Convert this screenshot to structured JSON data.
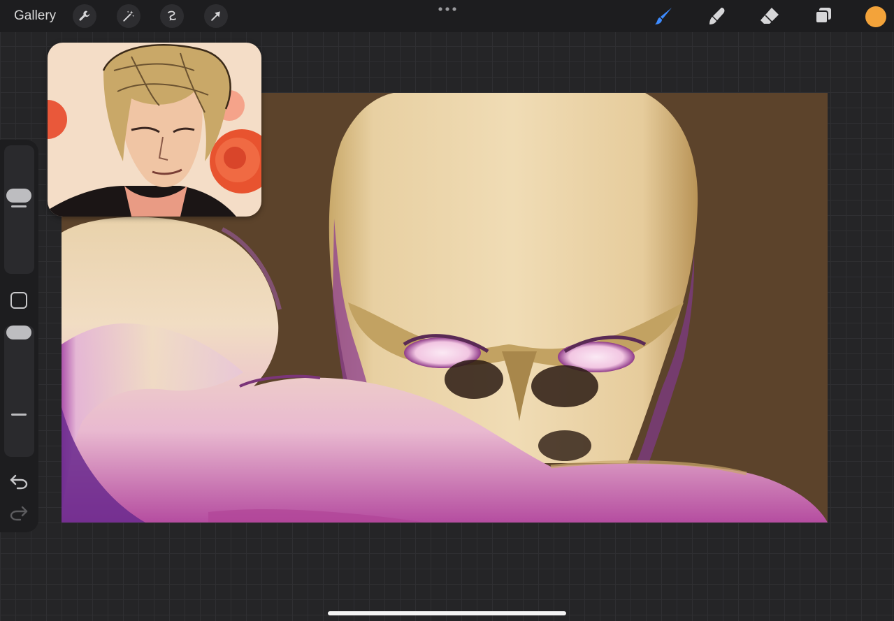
{
  "topbar": {
    "gallery_label": "Gallery",
    "left_tools": [
      "wrench-icon",
      "magic-wand-icon",
      "selection-icon",
      "transform-arrow-icon"
    ],
    "right_tools": [
      "brush-icon",
      "smudge-icon",
      "eraser-icon",
      "layers-icon"
    ],
    "active_tool": "brush-icon",
    "active_tool_color": "#3d8bff",
    "current_color": "#f3a33a"
  },
  "canvas": {
    "background_color": "#5c432b"
  },
  "sidebar": {
    "brush_size_level": 0.62,
    "opacity_level": 0.35,
    "undo_icon": "undo-icon",
    "redo_icon": "redo-icon"
  }
}
